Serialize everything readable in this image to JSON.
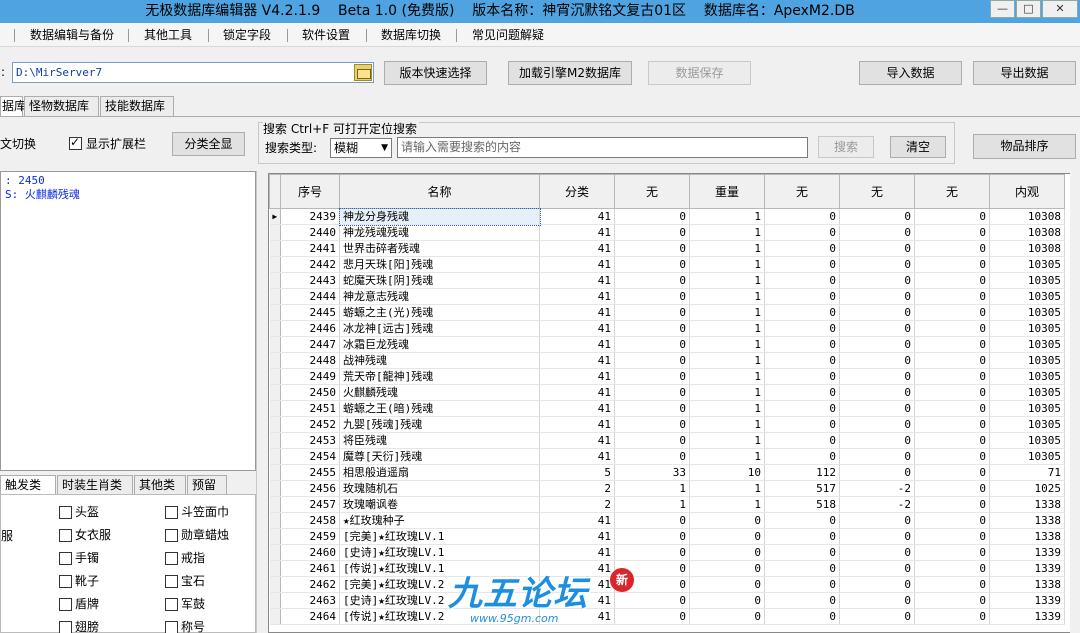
{
  "window": {
    "title": "无极数据库编辑器 V4.2.1.9    Beta 1.0 (免费版)    版本名称：神宵沉默铭文复古01区    数据库名：ApexM2.DB",
    "buttons": [
      "—",
      "□",
      "✕"
    ]
  },
  "menu": {
    "items": [
      "数据编辑与备份",
      "其他工具",
      "锁定字段",
      "软件设置",
      "数据库切换",
      "常见问题解疑"
    ]
  },
  "toolbar": {
    "path_label": ":",
    "path_value": "D:\\MirServer7",
    "version_select": "版本快速选择",
    "load_engine": "加载引擎M2数据库",
    "save_data": "数据保存",
    "import_data": "导入数据",
    "export_data": "导出数据"
  },
  "tabs": [
    "据库",
    "怪物数据库",
    "技能数据库"
  ],
  "options": {
    "switch_label": "文切换",
    "show_ext_label": "显示扩展栏",
    "show_ext_checked": true,
    "show_all_button": "分类全显"
  },
  "search": {
    "title": "搜索   Ctrl+F 可打开定位搜索",
    "type_label": "搜索类型:",
    "type_value": "模糊",
    "placeholder": "请输入需要搜索的内容",
    "search_button": "搜索",
    "clear_button": "清空",
    "sort_button": "物品排序"
  },
  "left_info": {
    "line1": ": 2450",
    "line2": "S: 火麒麟残魂"
  },
  "category_tabs": [
    "触发类",
    "时装生肖类",
    "其他类",
    "预留"
  ],
  "category_left": "服",
  "categories": {
    "col1": [
      "头盔",
      "女衣服",
      "手镯",
      "靴子",
      "盾牌",
      "翅膀"
    ],
    "col2": [
      "斗笠面巾",
      "勋章蜡烛",
      "戒指",
      "宝石",
      "军鼓",
      "称号"
    ]
  },
  "grid": {
    "headers": [
      "序号",
      "名称",
      "分类",
      "无",
      "重量",
      "无",
      "无",
      "无",
      "内观"
    ],
    "rows": [
      [
        "2439",
        "神龙分身残魂",
        "41",
        "0",
        "1",
        "0",
        "0",
        "0",
        "10308"
      ],
      [
        "2440",
        "神龙残魂残魂",
        "41",
        "0",
        "1",
        "0",
        "0",
        "0",
        "10308"
      ],
      [
        "2441",
        "世界击碎者残魂",
        "41",
        "0",
        "1",
        "0",
        "0",
        "0",
        "10308"
      ],
      [
        "2442",
        "悲月天珠[阳]残魂",
        "41",
        "0",
        "1",
        "0",
        "0",
        "0",
        "10305"
      ],
      [
        "2443",
        "蛇魔天珠[阴]残魂",
        "41",
        "0",
        "1",
        "0",
        "0",
        "0",
        "10305"
      ],
      [
        "2444",
        "神龙意志残魂",
        "41",
        "0",
        "1",
        "0",
        "0",
        "0",
        "10305"
      ],
      [
        "2445",
        "蝣螈之主(光)残魂",
        "41",
        "0",
        "1",
        "0",
        "0",
        "0",
        "10305"
      ],
      [
        "2446",
        "冰龙神[远古]残魂",
        "41",
        "0",
        "1",
        "0",
        "0",
        "0",
        "10305"
      ],
      [
        "2447",
        "冰霜巨龙残魂",
        "41",
        "0",
        "1",
        "0",
        "0",
        "0",
        "10305"
      ],
      [
        "2448",
        "战神残魂",
        "41",
        "0",
        "1",
        "0",
        "0",
        "0",
        "10305"
      ],
      [
        "2449",
        "荒天帝[龍神]残魂",
        "41",
        "0",
        "1",
        "0",
        "0",
        "0",
        "10305"
      ],
      [
        "2450",
        "火麒麟残魂",
        "41",
        "0",
        "1",
        "0",
        "0",
        "0",
        "10305"
      ],
      [
        "2451",
        "蝣螈之王(暗)残魂",
        "41",
        "0",
        "1",
        "0",
        "0",
        "0",
        "10305"
      ],
      [
        "2452",
        "九婴[残魂]残魂",
        "41",
        "0",
        "1",
        "0",
        "0",
        "0",
        "10305"
      ],
      [
        "2453",
        "将臣残魂",
        "41",
        "0",
        "1",
        "0",
        "0",
        "0",
        "10305"
      ],
      [
        "2454",
        "魔尊[天衍]残魂",
        "41",
        "0",
        "1",
        "0",
        "0",
        "0",
        "10305"
      ],
      [
        "2455",
        "相思般逍遥扇",
        "5",
        "33",
        "10",
        "112",
        "0",
        "0",
        "71"
      ],
      [
        "2456",
        "玫瑰随机石",
        "2",
        "1",
        "1",
        "517",
        "-2",
        "0",
        "1025"
      ],
      [
        "2457",
        "玫瑰嘲讽卷",
        "2",
        "1",
        "1",
        "518",
        "-2",
        "0",
        "1338"
      ],
      [
        "2458",
        "★红玫瑰种子",
        "41",
        "0",
        "0",
        "0",
        "0",
        "0",
        "1338"
      ],
      [
        "2459",
        "[完美]★红玫瑰LV.1",
        "41",
        "0",
        "0",
        "0",
        "0",
        "0",
        "1338"
      ],
      [
        "2460",
        "[史诗]★红玫瑰LV.1",
        "41",
        "0",
        "0",
        "0",
        "0",
        "0",
        "1339"
      ],
      [
        "2461",
        "[传说]★红玫瑰LV.1",
        "41",
        "0",
        "0",
        "0",
        "0",
        "0",
        "1339"
      ],
      [
        "2462",
        "[完美]★红玫瑰LV.2",
        "41",
        "0",
        "0",
        "0",
        "0",
        "0",
        "1338"
      ],
      [
        "2463",
        "[史诗]★红玫瑰LV.2",
        "41",
        "0",
        "0",
        "0",
        "0",
        "0",
        "1339"
      ],
      [
        "2464",
        "[传说]★红玫瑰LV.2",
        "41",
        "0",
        "0",
        "0",
        "0",
        "0",
        "1339"
      ]
    ]
  },
  "watermark": {
    "text": "九五论坛",
    "url": "www.95gm.com",
    "badge": "新"
  }
}
